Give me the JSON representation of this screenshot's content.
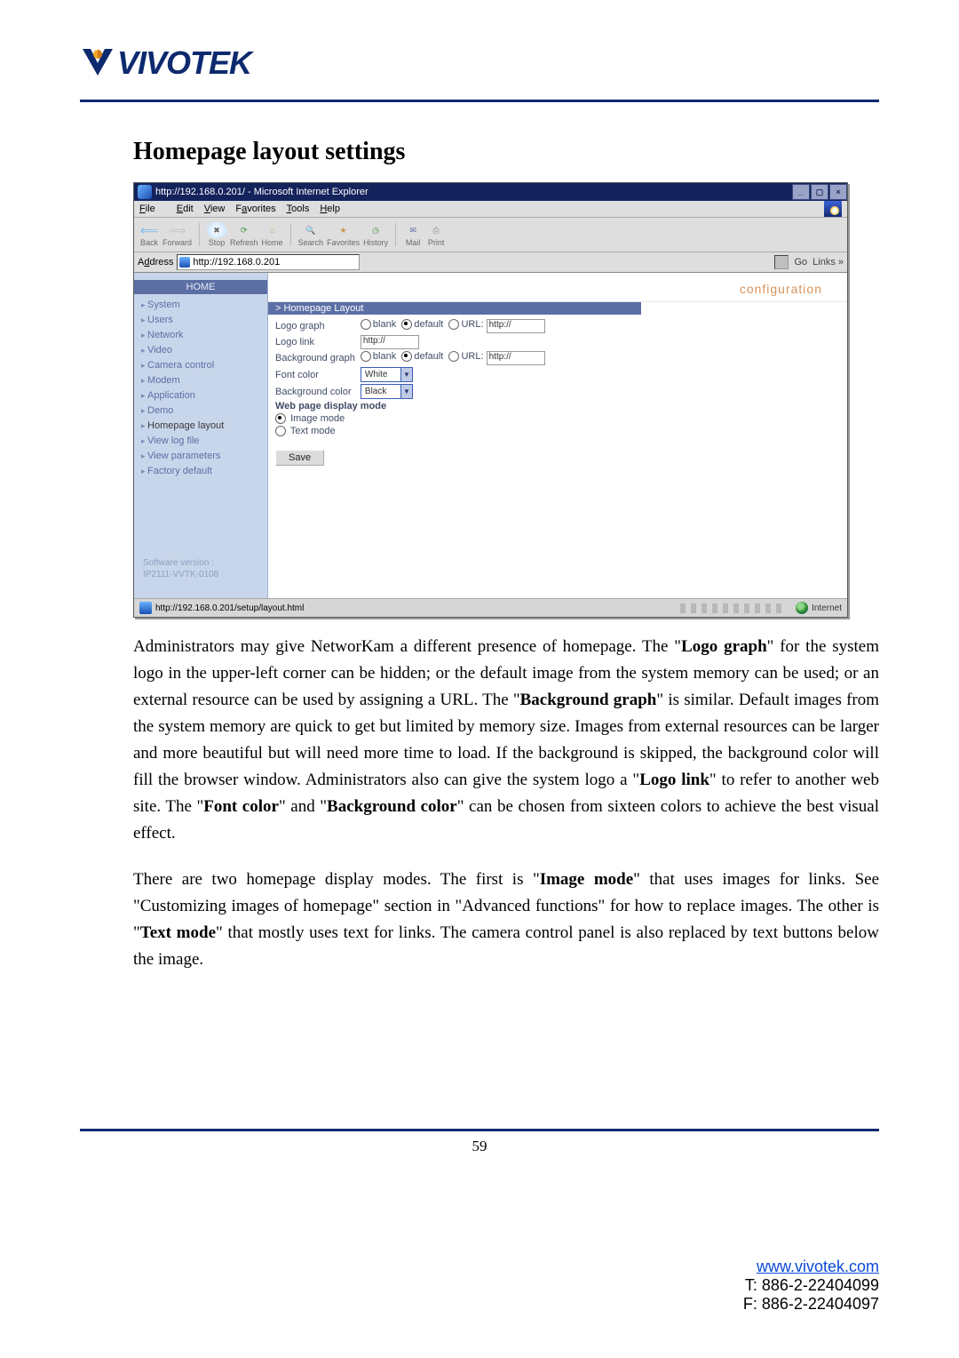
{
  "logo": {
    "text": "VIVOTEK"
  },
  "section_title": "Homepage layout settings",
  "screenshot": {
    "url_title": "http://192.168.0.201/ - Microsoft Internet Explorer",
    "menu": [
      "File",
      "Edit",
      "View",
      "Favorites",
      "Tools",
      "Help"
    ],
    "toolbar": [
      "Back",
      "Forward",
      "Stop",
      "Refresh",
      "Home",
      "Search",
      "Favorites",
      "History",
      "Mail",
      "Print"
    ],
    "address_label": "Address",
    "address_value": "http://192.168.0.201",
    "go": "Go",
    "links": "Links »",
    "config_label": "configuration",
    "sidebar_title": "HOME",
    "sidebar": [
      "System",
      "Users",
      "Network",
      "Video",
      "Camera control",
      "Modem",
      "Application",
      "Demo",
      "Homepage layout",
      "View log file",
      "View parameters",
      "Factory default"
    ],
    "version": [
      "Software version :",
      "IP2111-VVTK-0108"
    ],
    "panel_title": "> Homepage Layout",
    "fields": {
      "logo_graph": "Logo graph",
      "logo_link": "Logo link",
      "bg_graph": "Background graph",
      "font_color": "Font color",
      "bg_color": "Background color",
      "disp_mode": "Web page display mode",
      "img_mode": "Image mode",
      "txt_mode": "Text mode"
    },
    "opts": {
      "blank": "blank",
      "default": "default",
      "url": "URL:",
      "httpph": "http://"
    },
    "font_color_value": "White",
    "bg_color_value": "Black",
    "save": "Save",
    "status_left": "http://192.168.0.201/setup/layout.html",
    "status_right": "Internet"
  },
  "paragraph1_parts": {
    "t0": "Administrators may give NetworKam a different presence of homepage. The \"",
    "b1": "Logo graph",
    "t2": "\" for the system logo in the upper-left corner can be hidden; or the default image from the system memory can be used; or an external resource can be used by assigning a URL. The \"",
    "b3": "Background graph",
    "t4": "\" is similar. Default images from the system memory are quick to get but limited by memory size. Images from external resources can be larger and more beautiful but will need more time to load. If the background is skipped, the background color will fill the browser window. Administrators also can give the system logo a \"",
    "b5": "Logo link",
    "t6": "\" to refer to another web site. The \"",
    "b7": "Font color",
    "t8": "\" and \"",
    "b9": "Background color",
    "t10": "\" can be chosen from sixteen colors to achieve the best visual effect."
  },
  "paragraph2_parts": {
    "t0": "There are two homepage display modes. The first is \"",
    "b1": "Image mode",
    "t2": "\" that uses images for links. See \"Customizing images of homepage\" section in \"Advanced functions\" for how to replace images. The other is \"",
    "b3": "Text mode",
    "t4": "\" that mostly uses text for links. The camera control panel is also replaced by text buttons below the image."
  },
  "page_number": "59",
  "footer": {
    "link": "www.vivotek.com",
    "tel": "T: 886-2-22404099",
    "fax": "F: 886-2-22404097"
  }
}
